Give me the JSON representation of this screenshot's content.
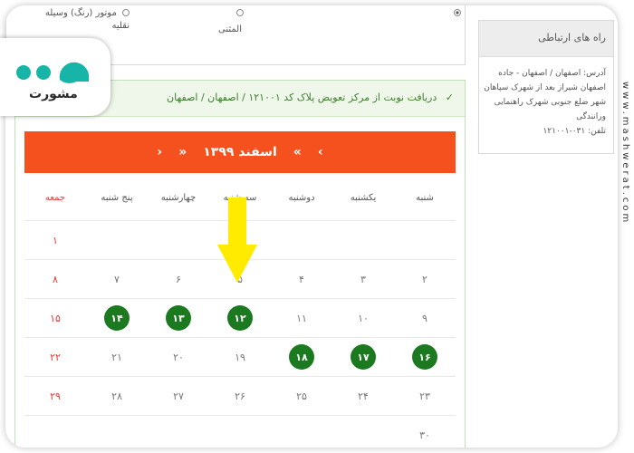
{
  "options": [
    {
      "line1": "موتور (رنگ) وسیله نقلیه",
      "line2": "",
      "checked": false
    },
    {
      "line1": "المثنی",
      "line2": "",
      "checked": false
    },
    {
      "line1": "",
      "line2": "",
      "checked": false
    },
    {
      "line1": "",
      "line2": "",
      "checked": true
    }
  ],
  "panel": {
    "header": "دریافت نوبت از مرکز تعویض پلاک کد ۱۲۱۰۰۱ / اصفهان / اصفهان",
    "check_icon": "✓"
  },
  "calendar": {
    "month_label": "اسفند ۱۳۹۹",
    "prev_year": "«",
    "next_year": "»",
    "prev_month": "‹",
    "next_month": "›",
    "weekdays": [
      "شنبه",
      "یکشنبه",
      "دوشنبه",
      "سه شنبه",
      "چهارشنبه",
      "پنج شنبه",
      "جمعه"
    ],
    "rows": [
      [
        "",
        "",
        "",
        "",
        "",
        "",
        "۱"
      ],
      [
        "۲",
        "۳",
        "۴",
        "۵",
        "۶",
        "۷",
        "۸"
      ],
      [
        "۹",
        "۱۰",
        "۱۱",
        "۱۲",
        "۱۳",
        "۱۴",
        "۱۵"
      ],
      [
        "۱۶",
        "۱۷",
        "۱۸",
        "۱۹",
        "۲۰",
        "۲۱",
        "۲۲"
      ],
      [
        "۲۳",
        "۲۴",
        "۲۵",
        "۲۶",
        "۲۷",
        "۲۸",
        "۲۹"
      ],
      [
        "۳۰",
        "",
        "",
        "",
        "",
        "",
        ""
      ]
    ],
    "available_days": [
      "۱۲",
      "۱۳",
      "۱۴",
      "۱۶",
      "۱۷",
      "۱۸"
    ],
    "highlighted_day": "۱۲"
  },
  "contact": {
    "title": "راه های ارتباطی",
    "address": "آدرس: اصفهان / اصفهان - جاده اصفهان شیراز بعد از شهرک سپاهان شهر ضلع جنوبی شهرک راهنمایی ورانندگی",
    "phone": "تلفن: ۰۳۱-۱۲۱۰۰۱"
  },
  "logo_text": "مشورت",
  "watermark": "www.mashwerat.com",
  "colors": {
    "calendar_bar": "#f4511e",
    "available_day": "#1b7a1f",
    "arrow": "#ffeb00",
    "friday": "#e53935"
  }
}
